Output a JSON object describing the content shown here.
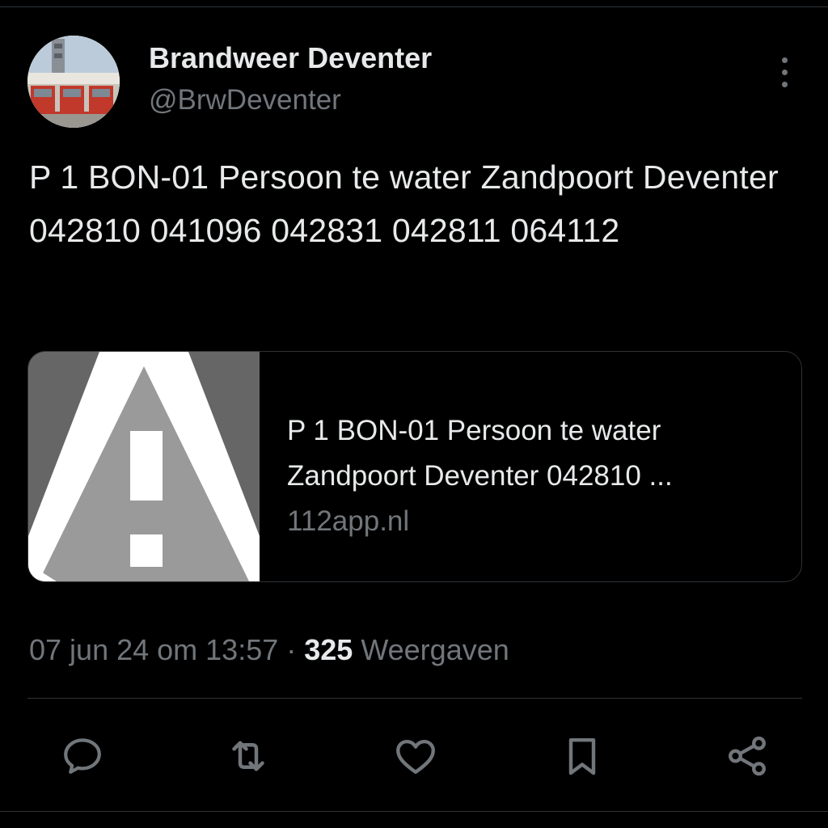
{
  "author": {
    "display_name": "Brandweer Deventer",
    "handle": "@BrwDeventer",
    "avatar_icon": "fire-station-photo"
  },
  "tweet": {
    "text": "P 1 BON-01 Persoon te water Zandpoort Deventer 042810 041096 042831 042811 064112"
  },
  "link_card": {
    "thumbnail_icon": "warning-triangle-icon",
    "title": "P 1 BON-01 Persoon te water Zandpoort Deventer 042810 ...",
    "domain": "112app.nl"
  },
  "meta": {
    "timestamp": "07 jun 24 om 13:57",
    "separator": " · ",
    "views_count": "325",
    "views_label": " Weergaven"
  },
  "actions": {
    "reply_icon": "reply-icon",
    "retweet_icon": "retweet-icon",
    "like_icon": "heart-icon",
    "bookmark_icon": "bookmark-icon",
    "share_icon": "share-icon"
  },
  "colors": {
    "background": "#000000",
    "primary_text": "#e7e9ea",
    "secondary_text": "#71767b",
    "divider": "#2f3336"
  }
}
